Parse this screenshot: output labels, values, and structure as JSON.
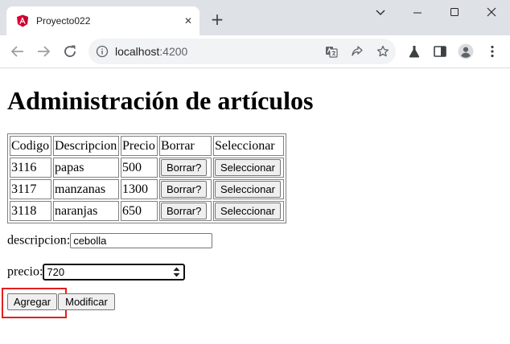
{
  "browser": {
    "tab_title": "Proyecto022",
    "url_host": "localhost",
    "url_port": ":4200"
  },
  "page": {
    "title": "Administración de artículos",
    "table": {
      "headers": [
        "Codigo",
        "Descripcion",
        "Precio",
        "Borrar",
        "Seleccionar"
      ],
      "rows": [
        {
          "codigo": "3116",
          "descripcion": "papas",
          "precio": "500",
          "borrar": "Borrar?",
          "seleccionar": "Seleccionar"
        },
        {
          "codigo": "3117",
          "descripcion": "manzanas",
          "precio": "1300",
          "borrar": "Borrar?",
          "seleccionar": "Seleccionar"
        },
        {
          "codigo": "3118",
          "descripcion": "naranjas",
          "precio": "650",
          "borrar": "Borrar?",
          "seleccionar": "Seleccionar"
        }
      ]
    },
    "form": {
      "descripcion_label": "descripcion:",
      "descripcion_value": "cebolla",
      "precio_label": "precio:",
      "precio_value": "720",
      "agregar_label": "Agregar",
      "modificar_label": "Modificar"
    }
  },
  "colors": {
    "highlight": "#e02020",
    "tabstrip": "#dee1e6",
    "angular_red": "#dd0031"
  }
}
